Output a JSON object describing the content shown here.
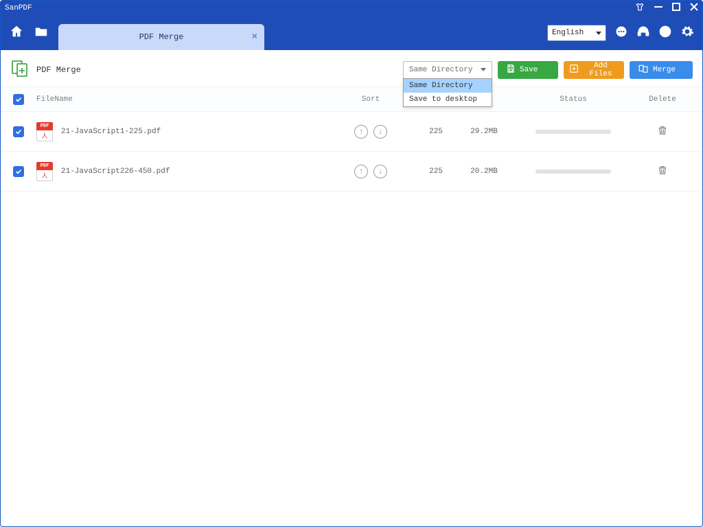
{
  "window": {
    "title": "SanPDF"
  },
  "menubar": {
    "tab_label": "PDF Merge",
    "language_selected": "English"
  },
  "toolbar": {
    "title": "PDF Merge",
    "dir_selected": "Same Directory",
    "dir_options": [
      "Same Directory",
      "Save to desktop"
    ],
    "save_label": "Save",
    "addfiles_label": "Add Files",
    "merge_label": "Merge"
  },
  "columns": {
    "filename": "FileName",
    "sort": "Sort",
    "status": "Status",
    "delete": "Delete"
  },
  "files": [
    {
      "name": "21-JavaScript1-225.pdf",
      "pages": "225",
      "size": "29.2MB"
    },
    {
      "name": "21-JavaScript226-450.pdf",
      "pages": "225",
      "size": "20.2MB"
    }
  ]
}
